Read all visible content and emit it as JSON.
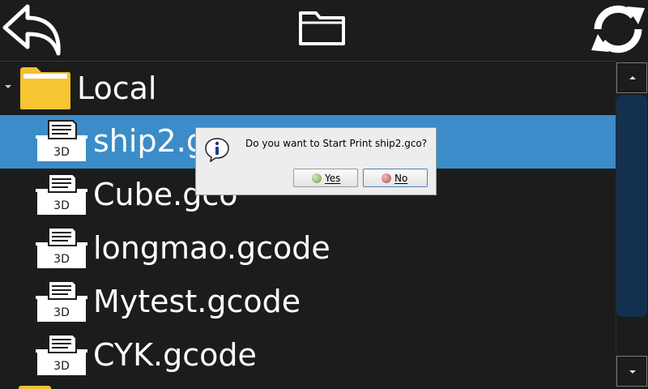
{
  "toolbar": {
    "back_icon": "back-arrow-icon",
    "folder_icon": "folder-icon",
    "refresh_icon": "refresh-icon"
  },
  "tree": {
    "root_label": "Local",
    "files": [
      {
        "name": "ship2.gco",
        "selected": true,
        "icon_text": "3D"
      },
      {
        "name": "Cube.gco",
        "selected": false,
        "icon_text": "3D"
      },
      {
        "name": "longmao.gcode",
        "selected": false,
        "icon_text": "3D"
      },
      {
        "name": "Mytest.gcode",
        "selected": false,
        "icon_text": "3D"
      },
      {
        "name": "CYK.gcode",
        "selected": false,
        "icon_text": "3D"
      }
    ]
  },
  "dialog": {
    "message": "Do you want to Start Print ship2.gco?",
    "yes_label": "Yes",
    "no_label": "No"
  },
  "colors": {
    "background": "#1c1c1c",
    "selection": "#3b8cc8",
    "folder": "#f0c030",
    "scroll_thumb": "#13304f"
  }
}
